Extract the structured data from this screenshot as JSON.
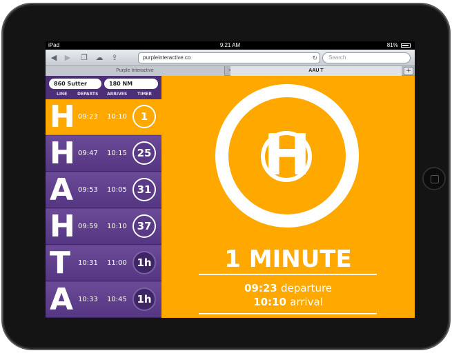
{
  "status_bar": {
    "device": "iPad",
    "time": "9:21 AM",
    "battery": "81%"
  },
  "browser": {
    "url": "purpleinteractive.co",
    "search_placeholder": "Search",
    "tabs": [
      {
        "label": "Purple Interactive"
      },
      {
        "label": "AAU T"
      }
    ],
    "tab_close": "×",
    "tab_add": "+"
  },
  "sidebar": {
    "stops": [
      "860 Sutter",
      "180 NM"
    ],
    "headers": {
      "line": "LINE",
      "departs": "DEPARTS",
      "arrives": "ARRIVES",
      "timer": "TIMER"
    },
    "rows": [
      {
        "line": "H",
        "departs": "09:23",
        "arrives": "10:10",
        "timer": "1"
      },
      {
        "line": "H",
        "departs": "09:47",
        "arrives": "10:15",
        "timer": "25"
      },
      {
        "line": "A",
        "departs": "09:53",
        "arrives": "10:05",
        "timer": "31"
      },
      {
        "line": "H",
        "departs": "09:59",
        "arrives": "10:10",
        "timer": "37"
      },
      {
        "line": "T",
        "departs": "10:31",
        "arrives": "11:00",
        "timer": "1h"
      },
      {
        "line": "A",
        "departs": "10:33",
        "arrives": "10:45",
        "timer": "1h"
      }
    ]
  },
  "main": {
    "line": "H",
    "countdown": "1 MINUTE",
    "departure_time": "09:23",
    "departure_label": "departure",
    "arrival_time": "10:10",
    "arrival_label": "arrival"
  },
  "colors": {
    "accent_orange": "#ffa800",
    "purple": "#5d3c8a"
  }
}
